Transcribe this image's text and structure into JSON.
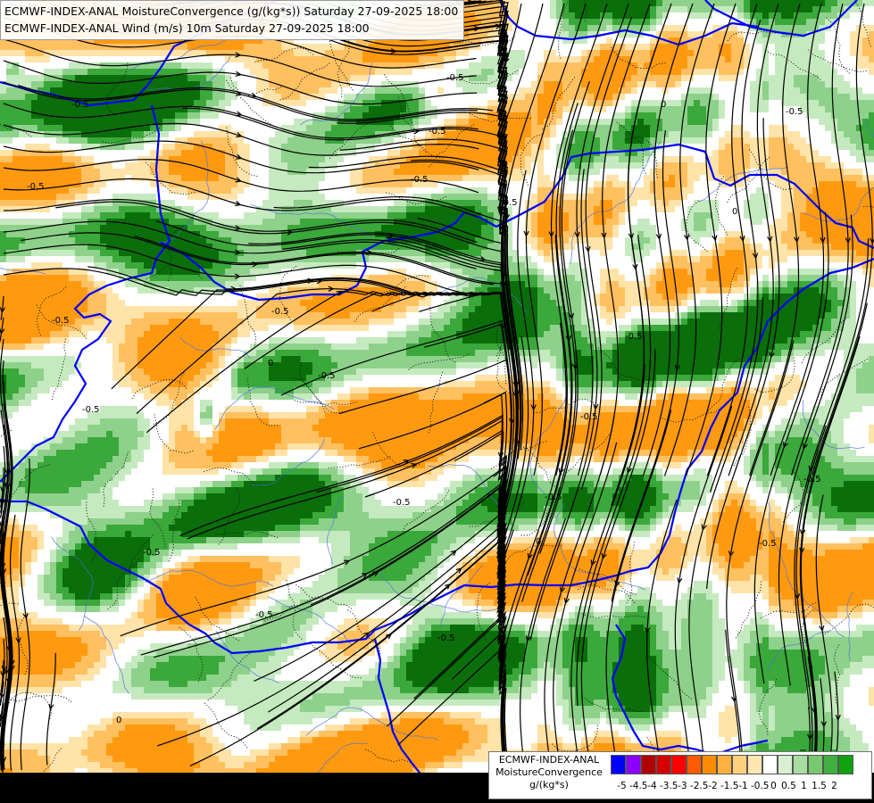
{
  "header": {
    "line1": "ECMWF-INDEX-ANAL MoistureConvergence (g/(kg*s)) Saturday 27-09-2025 18:00",
    "line2": "ECMWF-INDEX-ANAL Wind (m/s) 10m Saturday 27-09-2025 18:00"
  },
  "legend": {
    "line1": "ECMWF-INDEX-ANAL",
    "line2": "MoistureConvergence",
    "units": "g/(kg*s)",
    "swatch_colors": [
      "#0000ff",
      "#8b00ff",
      "#b00000",
      "#d40000",
      "#ff0000",
      "#ff5a00",
      "#ff8c00",
      "#ffb040",
      "#ffd080",
      "#ffe6b0",
      "#ffffff",
      "#d8f0d0",
      "#a8dca0",
      "#78c870",
      "#40b040",
      "#10a010"
    ],
    "tick_labels": [
      "-5",
      "-4.5",
      "-4",
      "-3.5",
      "-3",
      "-2.5",
      "-2",
      "-1.5",
      "-1",
      "-0.5",
      "0",
      "0.5",
      "1",
      "1.5",
      "2"
    ]
  },
  "map": {
    "field": "MoistureConvergence",
    "field_units": "g/(kg*s)",
    "wind_level": "10m",
    "contour_labels": [
      "-0.5",
      "-0.5",
      "-0.5",
      "-0.5",
      "-0.5",
      "-0.5",
      "-0.5",
      "-0.5",
      "-0.5",
      "-0.5",
      "-0.5",
      "-0.5",
      "-0.5",
      "-0.5",
      "-0.5",
      "-0.5",
      "-0.5",
      "-0.5",
      "-0.5",
      "-0.5",
      "0",
      "0",
      "0",
      "0",
      "0"
    ],
    "colors": {
      "border": "#0000ff",
      "river": "#4a6ee0",
      "streamline": "#000000",
      "convergence_light": "#c6eac0",
      "convergence_mid": "#8ed18a",
      "convergence_strong": "#3aa83a",
      "divergence_light": "#ffe3a8",
      "divergence_mid": "#ffc060",
      "divergence_strong": "#ff9a10"
    }
  }
}
